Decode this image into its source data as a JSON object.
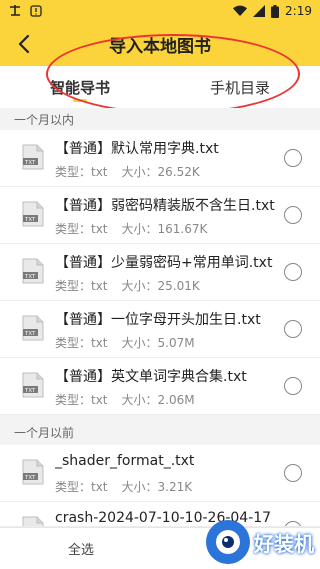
{
  "status_bar": {
    "left_icons": [
      "app-icon",
      "warning-icon"
    ],
    "right_icons": [
      "wifi-icon",
      "signal-icon",
      "battery-icon"
    ],
    "time": "2:19"
  },
  "header": {
    "title": "导入本地图书"
  },
  "tabs": [
    {
      "label": "智能导书",
      "active": true
    },
    {
      "label": "手机目录",
      "active": false
    }
  ],
  "sections": [
    {
      "title": "一个月以内",
      "files": [
        {
          "name": "【普通】默认常用字典.txt",
          "type_label": "类型：txt",
          "size_label": "大小：26.52K"
        },
        {
          "name": "【普通】弱密码精装版不含生日.txt",
          "type_label": "类型：txt",
          "size_label": "大小：161.67K"
        },
        {
          "name": "【普通】少量弱密码+常用单词.txt",
          "type_label": "类型：txt",
          "size_label": "大小：25.01K"
        },
        {
          "name": "【普通】一位字母开头加生日.txt",
          "type_label": "类型：txt",
          "size_label": "大小：5.07M"
        },
        {
          "name": "【普通】英文单词字典合集.txt",
          "type_label": "类型：txt",
          "size_label": "大小：2.06M"
        }
      ]
    },
    {
      "title": "一个月以前",
      "files": [
        {
          "name": "_shader_format_.txt",
          "type_label": "类型：txt",
          "size_label": "大小：3.21K"
        },
        {
          "name": "crash-2024-07-10-10-26-04-17",
          "type_label": "",
          "size_label": ""
        }
      ]
    }
  ],
  "bottom_bar": {
    "select_all": "全选"
  },
  "watermark": {
    "text": "好装机"
  },
  "colors": {
    "accent": "#fbd33a",
    "annotation": "#e33333"
  }
}
